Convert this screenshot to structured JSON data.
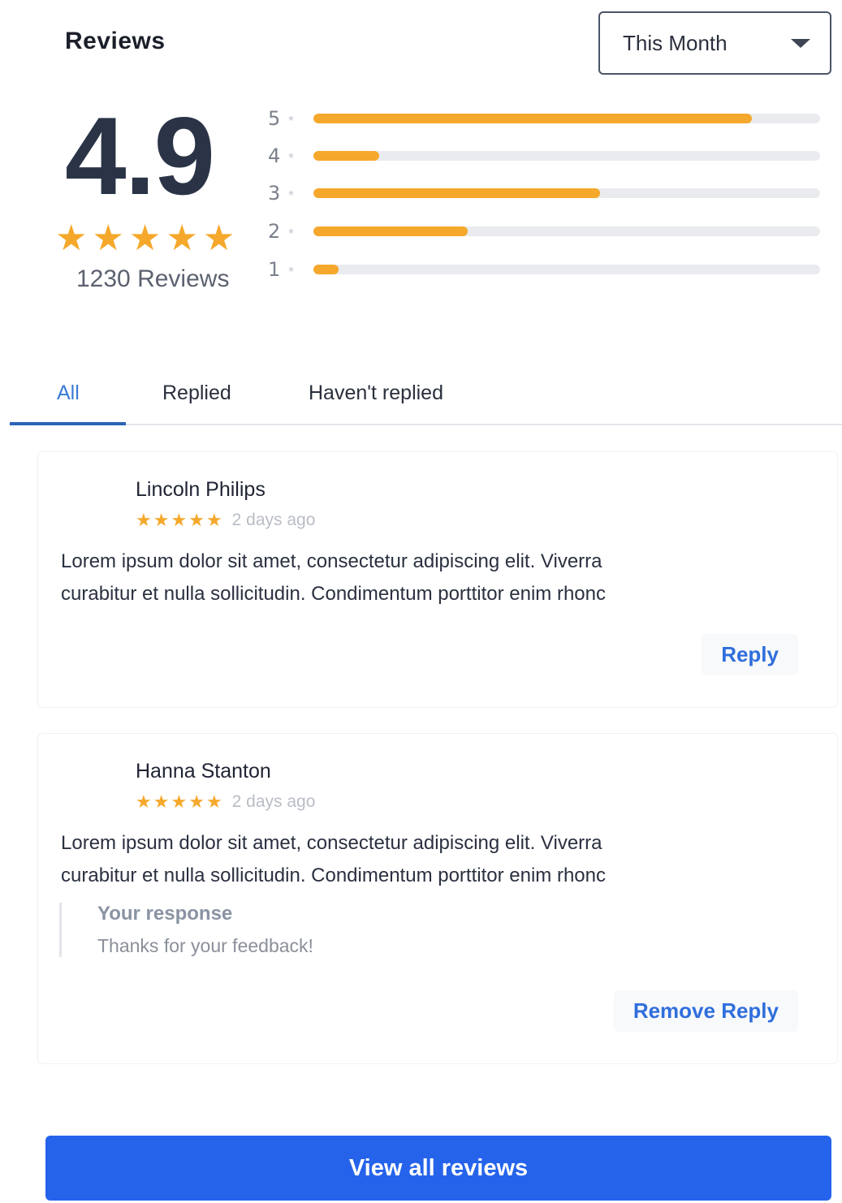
{
  "header": {
    "title": "Reviews"
  },
  "period_select": {
    "value": "This Month",
    "icon": "caret-down-icon"
  },
  "summary": {
    "average": "4.9",
    "stars": 5,
    "count_label": "1230 Reviews"
  },
  "distribution": [
    {
      "label": "5",
      "fraction": 0.865
    },
    {
      "label": "4",
      "fraction": 0.13
    },
    {
      "label": "3",
      "fraction": 0.565
    },
    {
      "label": "2",
      "fraction": 0.305
    },
    {
      "label": "1",
      "fraction": 0.05
    }
  ],
  "tabs": [
    {
      "label": "All",
      "active": true
    },
    {
      "label": "Replied",
      "active": false
    },
    {
      "label": "Haven't replied",
      "active": false
    }
  ],
  "reviews": [
    {
      "author": "Lincoln Philips",
      "rating": 5,
      "time": "2 days ago",
      "text_line1": "Lorem ipsum dolor sit amet, consectetur adipiscing elit. Viverra",
      "text_line2": "curabitur et nulla sollicitudin. Condimentum porttitor enim rhonc",
      "action_label": "Reply"
    },
    {
      "author": "Hanna Stanton",
      "rating": 5,
      "time": "2 days ago",
      "text_line1": "Lorem ipsum dolor sit amet, consectetur adipiscing elit. Viverra",
      "text_line2": "curabitur et nulla sollicitudin. Condimentum porttitor enim rhonc",
      "response_label": "Your response",
      "response_text": "Thanks for your feedback!",
      "action_label": "Remove Reply"
    }
  ],
  "footer": {
    "view_all_label": "View all reviews"
  },
  "colors": {
    "accent": "#2563eb",
    "star": "#f5a82b",
    "link": "#2f6fdc"
  }
}
